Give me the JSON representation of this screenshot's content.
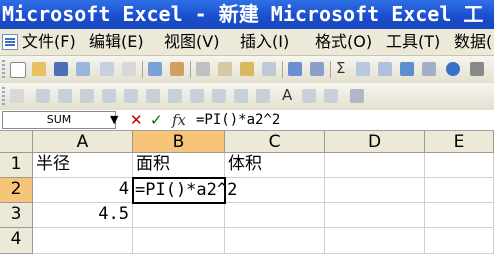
{
  "window": {
    "title": "Microsoft Excel - 新建 Microsoft Excel 工"
  },
  "menubar": {
    "items": [
      "文件(F)",
      "编辑(E)",
      "视图(V)",
      "插入(I)",
      "格式(O)",
      "工具(T)",
      "数据("
    ]
  },
  "formula_bar": {
    "name_box": "SUM",
    "formula": "=PI()*a2^2"
  },
  "sheet": {
    "columns": [
      "A",
      "B",
      "C",
      "D",
      "E"
    ],
    "rows": [
      "1",
      "2",
      "3",
      "4"
    ],
    "cells": {
      "A1": "半径",
      "B1": "面积",
      "C1": "体积",
      "A2": "4",
      "B2": "=PI()*a2^2",
      "A3": "4.5"
    },
    "active_cell": "B2"
  },
  "colors": {
    "title_bg": "#1a4fcf",
    "chrome": "#ece9d8",
    "selected_header": "#f7c57a"
  }
}
